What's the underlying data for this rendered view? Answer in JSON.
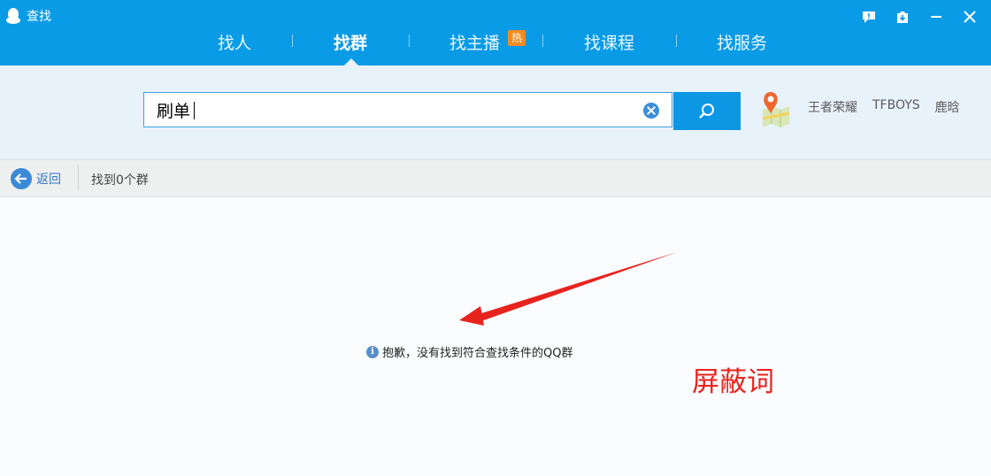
{
  "window": {
    "title": "查找",
    "icons": [
      "qq-penguin-icon",
      "feedback-icon",
      "save-icon"
    ]
  },
  "tabs": [
    {
      "label": "找人",
      "active": false
    },
    {
      "label": "找群",
      "active": true
    },
    {
      "label": "找主播",
      "active": false,
      "badge": "热"
    },
    {
      "label": "找课程",
      "active": false
    },
    {
      "label": "找服务",
      "active": false
    }
  ],
  "search": {
    "value": "刷单",
    "button_icon": "search-icon",
    "clear_icon": "clear-icon"
  },
  "hot_tags": [
    "王者荣耀",
    "TFBOYS",
    "鹿晗"
  ],
  "subbar": {
    "back_label": "返回",
    "result_count": "找到0个群"
  },
  "result": {
    "empty_message": "抱歉，没有找到符合查找条件的QQ群"
  },
  "annotation": {
    "text": "屏蔽词",
    "color": "#e8231e"
  },
  "colors": {
    "header": "#0a9be6",
    "hot_badge": "#f58b1f",
    "link": "#2f7ac7"
  }
}
